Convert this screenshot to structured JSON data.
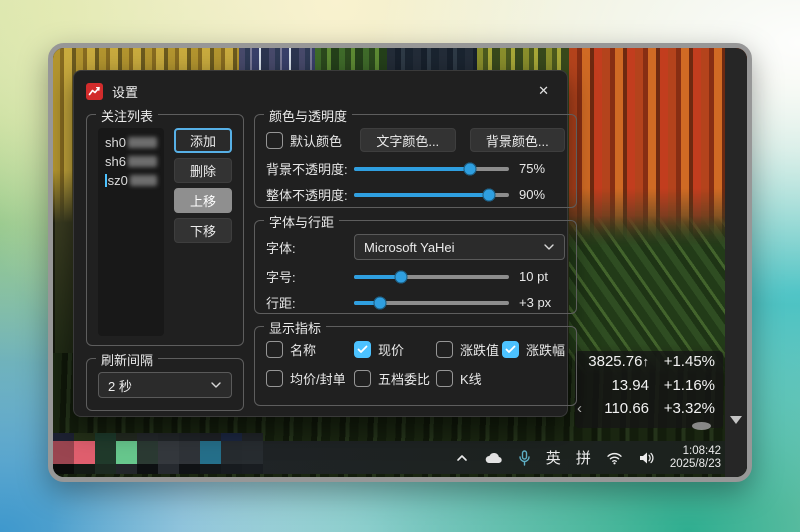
{
  "colors": {
    "accent": "#2f9fe0",
    "check_blue": "#4cc2ff",
    "app_icon_red": "#d22c2c"
  },
  "desktop": {
    "ticker": {
      "rows": [
        {
          "pre": "",
          "value": "3825.76",
          "post": "↑",
          "change": "+1.45%"
        },
        {
          "pre": "",
          "value": "13.94",
          "post": "",
          "change": "+1.16%"
        },
        {
          "pre": "‹",
          "value": "110.66",
          "post": "",
          "change": "+3.32%"
        }
      ]
    },
    "taskbar": {
      "mosaic": {
        "row1": [
          "#1d2132",
          "#243018",
          "#1d3a2b",
          "#232a21",
          "#24282b",
          "#222629",
          "#1f2327",
          "#1e2126",
          "#1b2640",
          "#202428"
        ],
        "row2": [
          "#9a4550",
          "#e05f6e",
          "#203a2b",
          "#67c78d",
          "#2b3a33",
          "#34383d",
          "#2f3338",
          "#256f8a",
          "#262b2f",
          "#272c30"
        ],
        "row3": [
          "#0a0c0b",
          "#131a15",
          "#1c2a21",
          "#22262a",
          "#0d1012",
          "#262a2f",
          "#0f1215",
          "#13171a",
          "#171b1f",
          "#191d21"
        ]
      },
      "tray": {
        "ime_en": "英",
        "ime_pinyin": "拼",
        "time": "1:08:42",
        "date": "2025/8/23"
      }
    }
  },
  "dialog": {
    "title": "设置",
    "close_glyph": "✕",
    "watchlist": {
      "legend": "关注列表",
      "items": [
        {
          "prefix": "sh0"
        },
        {
          "prefix": "sh6"
        },
        {
          "prefix": "sz0"
        }
      ],
      "buttons": {
        "add": "添加",
        "delete": "删除",
        "move_up": "上移",
        "move_down": "下移"
      }
    },
    "refresh": {
      "legend": "刷新间隔",
      "value": "2 秒"
    },
    "colors": {
      "legend": "颜色与透明度",
      "default_color_label": "默认颜色",
      "default_color_checked": false,
      "text_color_btn": "文字颜色...",
      "bg_color_btn": "背景颜色...",
      "bg_opacity": {
        "label": "背景不透明度:",
        "value": "75%",
        "percent": 75
      },
      "overall_opacity": {
        "label": "整体不透明度:",
        "value": "90%",
        "percent": 87
      }
    },
    "font": {
      "legend": "字体与行距",
      "family_label": "字体:",
      "family_value": "Microsoft YaHei",
      "size": {
        "label": "字号:",
        "value": "10 pt",
        "percent": 30
      },
      "spacing": {
        "label": "行距:",
        "value": "+3 px",
        "percent": 17
      }
    },
    "indicators": {
      "legend": "显示指标",
      "items": [
        {
          "label": "名称",
          "checked": false
        },
        {
          "label": "现价",
          "checked": true
        },
        {
          "label": "涨跌值",
          "checked": false
        },
        {
          "label": "涨跌幅",
          "checked": true
        },
        {
          "label": "均价/封单",
          "checked": false
        },
        {
          "label": "五档委比",
          "checked": false
        },
        {
          "label": "K线",
          "checked": false
        }
      ]
    }
  }
}
